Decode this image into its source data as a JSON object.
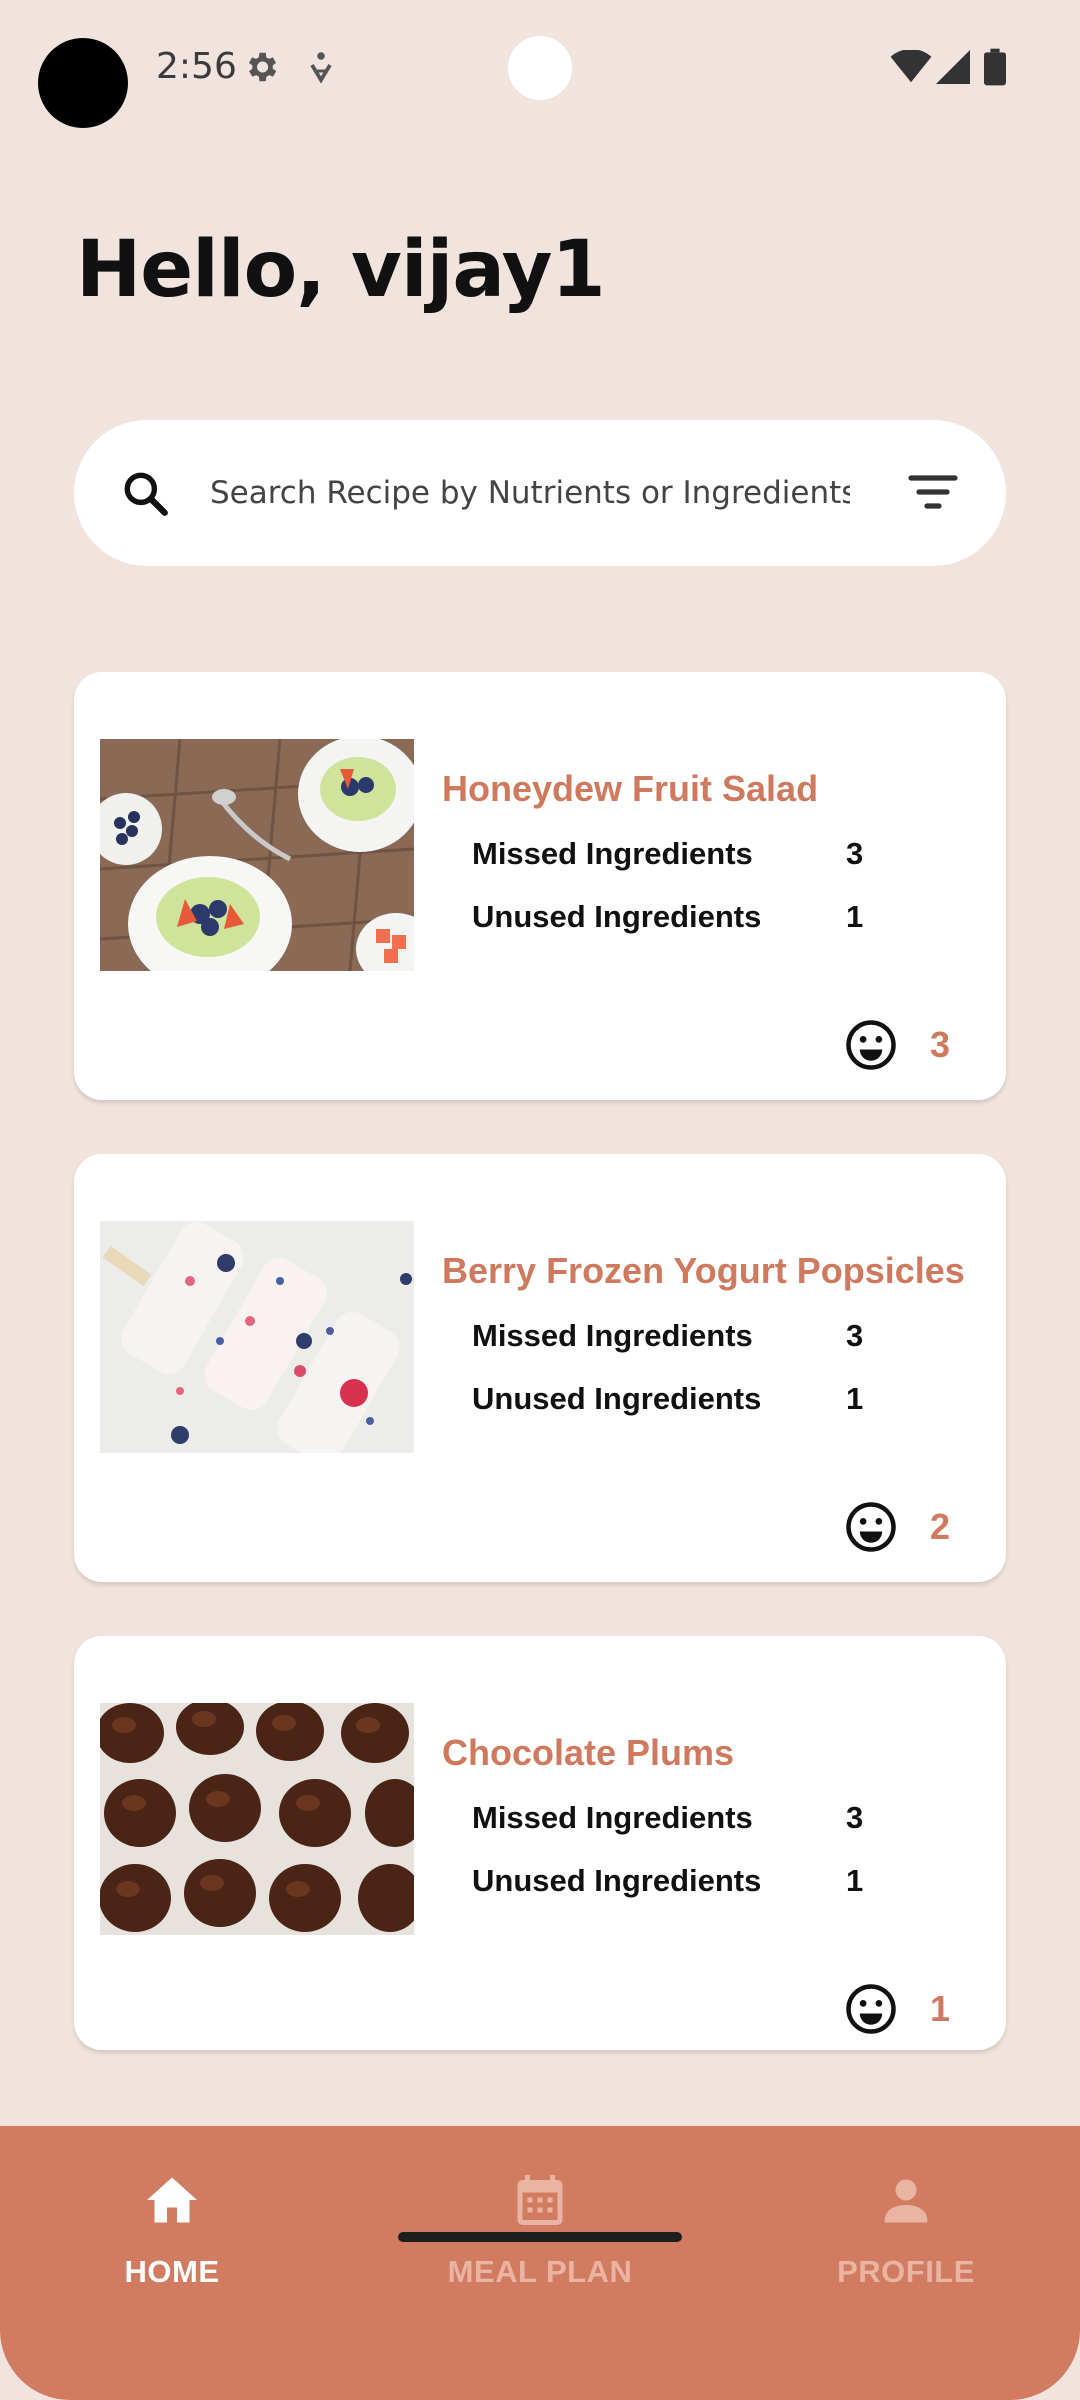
{
  "status_bar": {
    "time": "2:56"
  },
  "greeting": "Hello, vijay1",
  "search": {
    "placeholder": "Search Recipe by Nutrients or Ingredients",
    "value": ""
  },
  "recipes": [
    {
      "title": "Honeydew Fruit Salad",
      "missed_label": "Missed Ingredients",
      "missed": "3",
      "unused_label": "Unused Ingredients",
      "unused": "1",
      "likes": "3"
    },
    {
      "title": "Berry Frozen Yogurt Popsicles",
      "missed_label": "Missed Ingredients",
      "missed": "3",
      "unused_label": "Unused Ingredients",
      "unused": "1",
      "likes": "2"
    },
    {
      "title": "Chocolate Plums",
      "missed_label": "Missed Ingredients",
      "missed": "3",
      "unused_label": "Unused Ingredients",
      "unused": "1",
      "likes": "1"
    }
  ],
  "nav": {
    "home": "HOME",
    "meal_plan": "MEAL PLAN",
    "profile": "PROFILE"
  },
  "colors": {
    "background": "#f1e3dd",
    "accent": "#cf7a5e",
    "nav_bg": "#d17b60",
    "nav_active": "#ffffff",
    "nav_inactive": "#eab4a3"
  },
  "icons": {
    "status": [
      "gear-icon",
      "accessibility-icon",
      "wifi-icon",
      "signal-icon",
      "battery-icon"
    ],
    "search": "search-icon",
    "filter": "filter-icon",
    "card": "smiley-icon",
    "nav": [
      "home-icon",
      "calendar-icon",
      "person-icon"
    ]
  }
}
